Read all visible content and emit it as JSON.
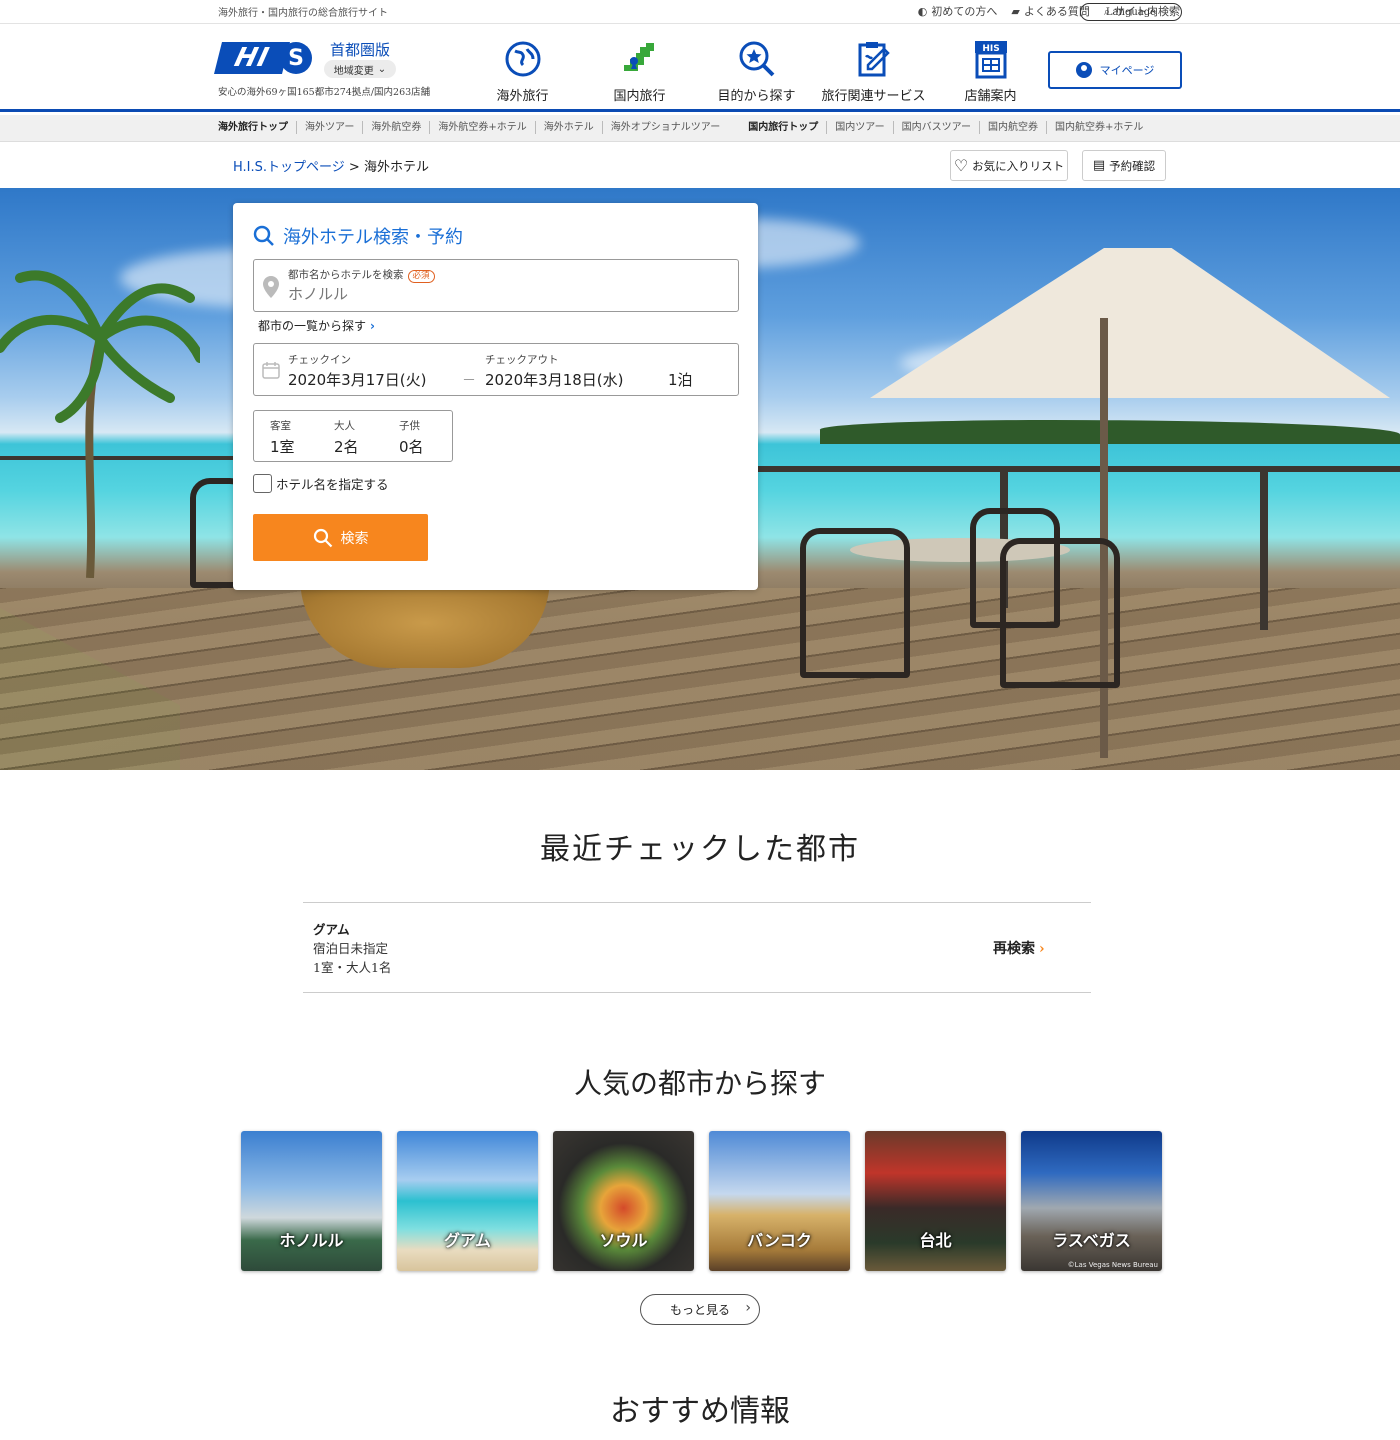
{
  "utility": {
    "tagline": "海外旅行・国内旅行の総合旅行サイト",
    "links": [
      "初めての方へ",
      "よくある質問",
      "サイト内検索"
    ],
    "language": "Language"
  },
  "header": {
    "logo_text": "H.I.S",
    "region_name": "首都圏版",
    "region_change": "地域変更",
    "subtag": "安心の海外69ヶ国165都市274拠点/国内263店舗",
    "nav": [
      {
        "label": "海外旅行",
        "icon": "globe-icon"
      },
      {
        "label": "国内旅行",
        "icon": "japan-map-icon"
      },
      {
        "label": "目的から探す",
        "icon": "search-star-icon"
      },
      {
        "label": "旅行関連サービス",
        "icon": "clipboard-pen-icon"
      },
      {
        "label": "店舗案内",
        "icon": "his-store-icon"
      }
    ],
    "store_badge": "HIS",
    "mypage": "マイページ"
  },
  "subnav": {
    "items": [
      "海外旅行トップ",
      "海外ツアー",
      "海外航空券",
      "海外航空券+ホテル",
      "海外ホテル",
      "海外オプショナルツアー",
      "国内旅行トップ",
      "国内ツアー",
      "国内バスツアー",
      "国内航空券",
      "国内航空券+ホテル"
    ]
  },
  "breadcrumb": {
    "home": "H.I.S.トップページ",
    "separator": ">",
    "current": "海外ホテル"
  },
  "buttons": {
    "favorites": "お気に入りリスト",
    "reservation": "予約確認"
  },
  "search": {
    "title": "海外ホテル検索・予約",
    "dest_label": "都市名からホテルを検索",
    "required": "必須",
    "dest_placeholder": "ホノルル",
    "city_list": "都市の一覧から探す",
    "checkin_label": "チェックイン",
    "checkin_value": "2020年3月17日(火)",
    "date_dash": "－",
    "checkout_label": "チェックアウト",
    "checkout_value": "2020年3月18日(水)",
    "nights": "1泊",
    "rooms_label": "客室",
    "rooms_value": "1室",
    "adults_label": "大人",
    "adults_value": "2名",
    "children_label": "子供",
    "children_value": "0名",
    "hotel_name_check": "ホテル名を指定する",
    "search_button": "検索"
  },
  "recent": {
    "heading": "最近チェックした都市",
    "city": "グアム",
    "dates": "宿泊日未指定",
    "guests": "1室・大人1名",
    "research": "再検索"
  },
  "popular": {
    "heading": "人気の都市から探す",
    "cities": [
      "ホノルル",
      "グアム",
      "ソウル",
      "バンコク",
      "台北",
      "ラスベガス"
    ],
    "credit": "©Las Vegas News Bureau",
    "more": "もっと見る"
  },
  "recommend": {
    "heading": "おすすめ情報"
  },
  "colors": {
    "brand_blue": "#0a4db8",
    "link_blue": "#1a6fd6",
    "accent_orange": "#f7861e"
  }
}
